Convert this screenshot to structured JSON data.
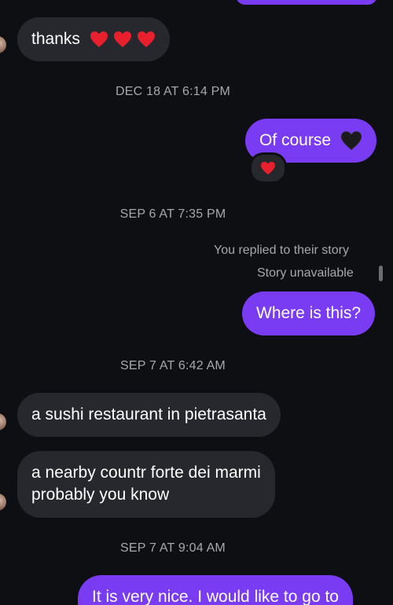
{
  "messages": {
    "thanks": {
      "text": "thanks"
    },
    "of_course": {
      "text": "Of course"
    },
    "story_reply_label": "You replied to their story",
    "story_unavailable": "Story unavailable",
    "where_is_this": {
      "text": "Where is this?"
    },
    "sushi": {
      "text": "a sushi restaurant in pietrasanta"
    },
    "nearby": {
      "line1": "a nearby countr forte dei marmi",
      "line2": "probably you know"
    },
    "very_nice": {
      "text": "It is very nice. I would like to go to"
    }
  },
  "timestamps": {
    "t1": "DEC 18 AT 6:14 PM",
    "t2": "SEP 6 AT 7:35 PM",
    "t3": "SEP 7 AT 6:42 AM",
    "t4": "SEP 7 AT 9:04 AM"
  },
  "colors": {
    "background": "#0d0f12",
    "incoming_bubble": "#26282d",
    "outgoing_bubble": "#7a3cf2",
    "meta_text": "#a6a8ad"
  },
  "icons": {
    "reaction": "red-heart-icon",
    "thanks_emojis": [
      "red-heart-icon",
      "red-heart-icon",
      "red-heart-icon"
    ],
    "of_course_emoji": "black-heart-icon"
  }
}
